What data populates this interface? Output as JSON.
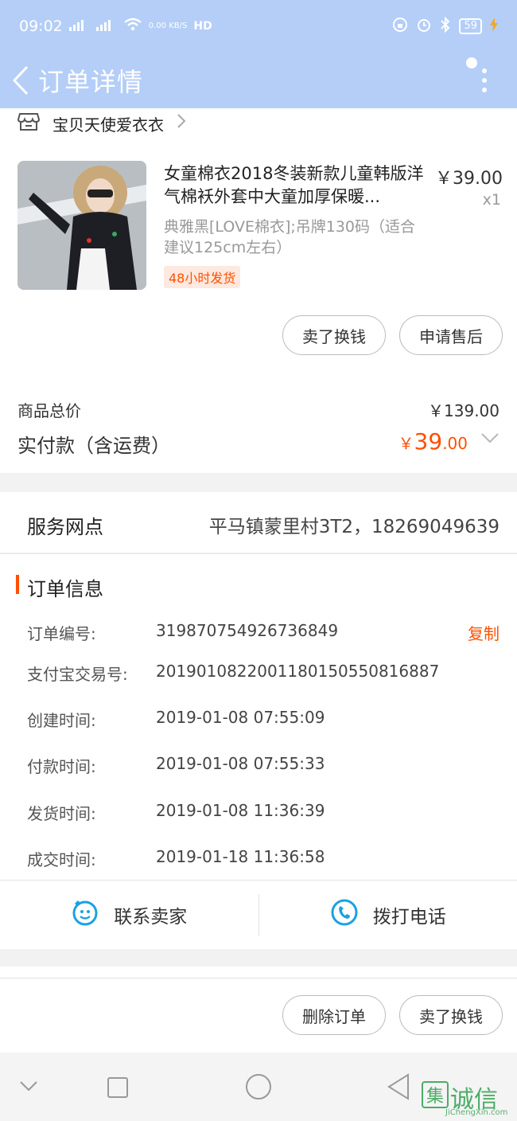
{
  "status_bar": {
    "time": "09:02",
    "signal1": "4G",
    "signal2": "2G",
    "net_speed": "0.00 KB/S",
    "hd": "HD",
    "battery": "59"
  },
  "header": {
    "title": "订单详情"
  },
  "shop": {
    "name": "宝贝天使爱衣衣"
  },
  "item": {
    "title": "女童棉衣2018冬装新款儿童韩版洋气棉袄外套中大童加厚保暖...",
    "price": "￥39.00",
    "qty": "x1",
    "sku": "典雅黑[LOVE棉衣];吊牌130码（适合建议125cm左右）",
    "tag": "48小时发货"
  },
  "item_actions": {
    "sell_label": "卖了换钱",
    "aftersale_label": "申请售后"
  },
  "summary": {
    "total_label": "商品总价",
    "total_value": "￥139.00",
    "paid_label": "实付款（含运费）",
    "paid_yen": "￥",
    "paid_int": "39",
    "paid_dec": ".00"
  },
  "service": {
    "label": "服务网点",
    "value": "平马镇蒙里村3T2，18269049639"
  },
  "order_info": {
    "title": "订单信息",
    "copy_label": "复制",
    "rows": [
      {
        "label": "订单编号:",
        "value": "319870754926736849"
      },
      {
        "label": "支付宝交易号:",
        "value": "2019010822001180150550816887"
      },
      {
        "label": "创建时间:",
        "value": "2019-01-08 07:55:09"
      },
      {
        "label": "付款时间:",
        "value": "2019-01-08 07:55:33"
      },
      {
        "label": "发货时间:",
        "value": "2019-01-08 11:36:39"
      },
      {
        "label": "成交时间:",
        "value": "2019-01-18 11:36:58"
      }
    ]
  },
  "contact": {
    "seller_label": "联系卖家",
    "phone_label": "拨打电话"
  },
  "footer_actions": {
    "delete_label": "删除订单",
    "sell_label": "卖了换钱"
  },
  "watermark": {
    "text": "诚信",
    "logo_char": "集",
    "sub": "JiChengXin.com"
  },
  "colors": {
    "header_bg": "#b4cef7",
    "accent": "#ff5000",
    "link_blue": "#1ba1e2"
  }
}
